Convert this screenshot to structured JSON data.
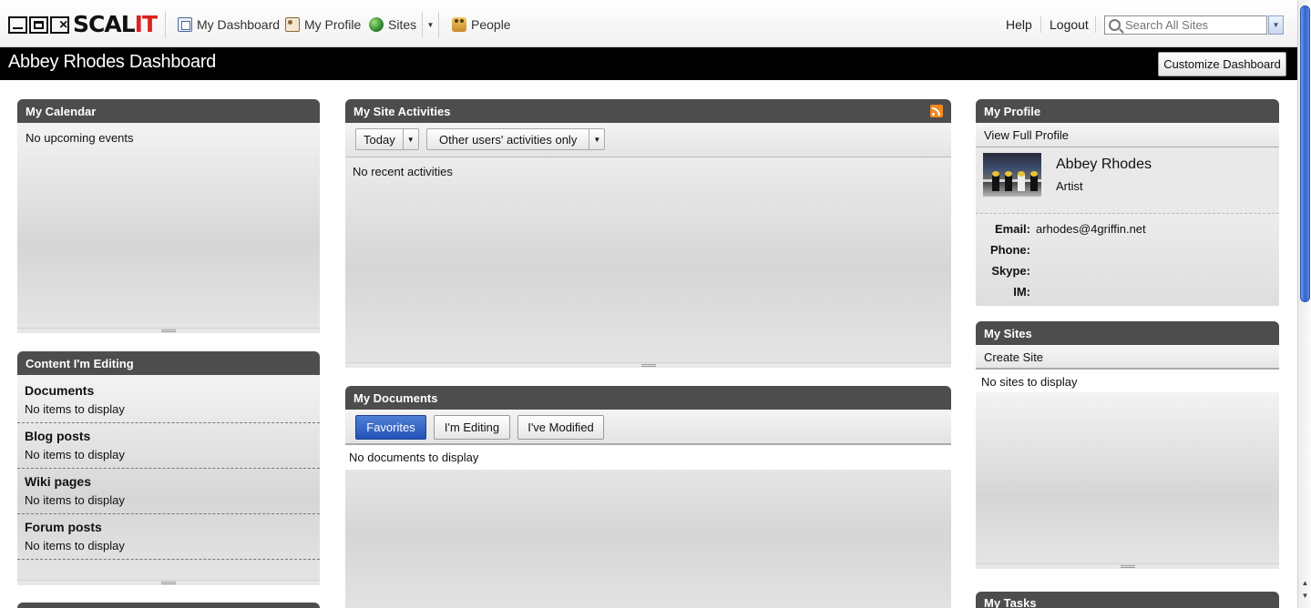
{
  "logo": {
    "mark": "SCAL",
    "mark_accent": "IT",
    "brand_color": "#e0201c"
  },
  "nav": {
    "items": [
      {
        "label": "My Dashboard",
        "icon": "dashboard-icon"
      },
      {
        "label": "My Profile",
        "icon": "profile-icon"
      },
      {
        "label": "Sites",
        "icon": "globe-icon"
      },
      {
        "label": "People",
        "icon": "people-icon"
      }
    ],
    "help": "Help",
    "logout": "Logout",
    "search_placeholder": "Search All Sites"
  },
  "page": {
    "title": "Abbey Rhodes Dashboard",
    "customize_label": "Customize Dashboard"
  },
  "calendar": {
    "title": "My Calendar",
    "empty": "No upcoming events"
  },
  "editing": {
    "title": "Content I'm Editing",
    "sections": [
      {
        "title": "Documents",
        "empty": "No items to display"
      },
      {
        "title": "Blog posts",
        "empty": "No items to display"
      },
      {
        "title": "Wiki pages",
        "empty": "No items to display"
      },
      {
        "title": "Forum posts",
        "empty": "No items to display"
      }
    ]
  },
  "activities": {
    "title": "My Site Activities",
    "range_filter": "Today",
    "user_filter": "Other users' activities only",
    "empty": "No recent activities"
  },
  "documents": {
    "title": "My Documents",
    "tabs": [
      "Favorites",
      "I'm Editing",
      "I've Modified"
    ],
    "active_tab": "Favorites",
    "empty": "No documents to display"
  },
  "profile": {
    "title": "My Profile",
    "view_full": "View Full Profile",
    "name": "Abbey Rhodes",
    "job_title": "Artist",
    "fields": [
      {
        "label": "Email:",
        "value": "arhodes@4griffin.net"
      },
      {
        "label": "Phone:",
        "value": ""
      },
      {
        "label": "Skype:",
        "value": ""
      },
      {
        "label": "IM:",
        "value": ""
      }
    ]
  },
  "sites": {
    "title": "My Sites",
    "create": "Create Site",
    "empty": "No sites to display"
  },
  "tasks": {
    "title": "My Tasks"
  },
  "colors": {
    "header_dark": "#4d4d4d",
    "title_bar": "#000000",
    "active_tab": "#2f5fc4"
  }
}
